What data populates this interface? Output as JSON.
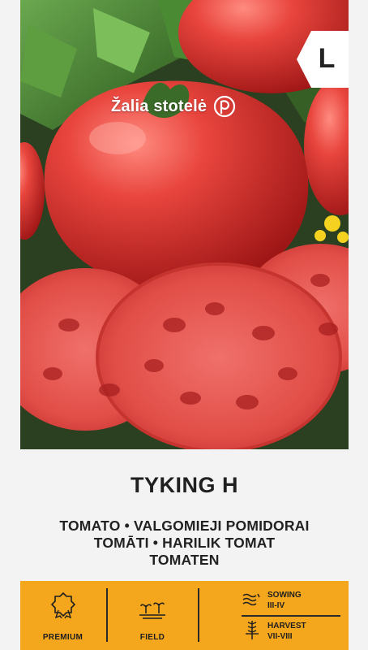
{
  "brand": {
    "name": "Žalia stotelė",
    "logo_icon": "leaf-circle-icon"
  },
  "badge": {
    "label": "L"
  },
  "product": {
    "name": "TYKING H",
    "subtitle_line1": "TOMATO • VALGOMIEJI POMIDORAI",
    "subtitle_line2": "TOMĀTI • HARILIK TOMAT",
    "subtitle_line3": "TOMATEN"
  },
  "features": {
    "premium_label": "PREMIUM",
    "premium_icon": "award-rosette-icon",
    "field_label": "FIELD",
    "field_icon": "field-sprout-icon",
    "sowing_title": "SOWING",
    "sowing_value": "III-IV",
    "sowing_icon": "water-waves-icon",
    "harvest_title": "HARVEST",
    "harvest_value": "VII-VIII",
    "harvest_icon": "wheat-icon"
  },
  "colors": {
    "band": "#f4a61d",
    "text": "#1f1f1f"
  }
}
